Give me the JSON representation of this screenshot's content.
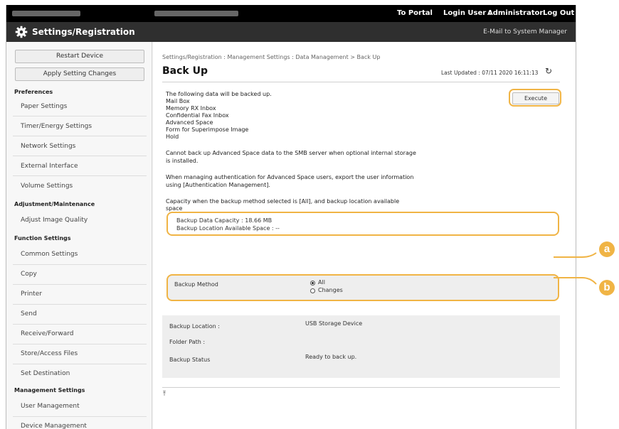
{
  "topbar": {
    "to_portal": "To Portal",
    "login_user": "Login User :",
    "user_name": "Administrator",
    "log_out": "Log Out"
  },
  "app": {
    "title": "Settings/Registration",
    "mail_link": "E-Mail to System Manager"
  },
  "sidebar": {
    "restart": "Restart Device",
    "apply": "Apply Setting Changes",
    "preferences": "Preferences",
    "paper": "Paper Settings",
    "timer": "Timer/Energy Settings",
    "network": "Network Settings",
    "external": "External Interface",
    "volume": "Volume Settings",
    "adjustment": "Adjustment/Maintenance",
    "image_quality": "Adjust Image Quality",
    "function": "Function Settings",
    "common": "Common Settings",
    "copy": "Copy",
    "printer": "Printer",
    "send": "Send",
    "receive": "Receive/Forward",
    "store": "Store/Access Files",
    "destination": "Set Destination",
    "management": "Management Settings",
    "user_mgmt": "User Management",
    "device_mgmt": "Device Management"
  },
  "content": {
    "breadcrumb": "Settings/Registration : Management Settings : Data Management > Back Up",
    "title": "Back Up",
    "last_updated": "Last Updated : 07/11 2020 16:11:13",
    "execute": "Execute",
    "intro": "The following data will be backed up.",
    "items": [
      "Mail Box",
      "Memory RX Inbox",
      "Confidential Fax Inbox",
      "Advanced Space",
      "Form for Superimpose Image",
      "Hold"
    ],
    "note1_line1": "Cannot back up Advanced Space data to the SMB server when optional internal storage",
    "note1_line2": "is installed.",
    "note2_line1": "When managing authentication for Advanced Space users, export the user information",
    "note2_line2": "using [Authentication Management].",
    "note3_line1": "Capacity when the backup method selected is [All], and backup location available",
    "note3_line2": "space",
    "capacity": "Backup Data Capacity : 18.66 MB",
    "available": "Backup Location Available Space : --",
    "method_label": "Backup Method",
    "method_all": "All",
    "method_changes": "Changes",
    "location_label": "Backup Location :",
    "location_value": "USB Storage Device",
    "folder_label": "Folder Path :",
    "status_label": "Backup Status",
    "status_value": "Ready to back up."
  },
  "callouts": {
    "a": "a",
    "b": "b"
  },
  "colors": {
    "accent": "#f0b445",
    "topbar": "#000000",
    "titlebar": "#2f2f2f"
  },
  "icons": {
    "settings": "gear-icon",
    "refresh": "refresh-icon",
    "top": "top-arrow-icon"
  }
}
